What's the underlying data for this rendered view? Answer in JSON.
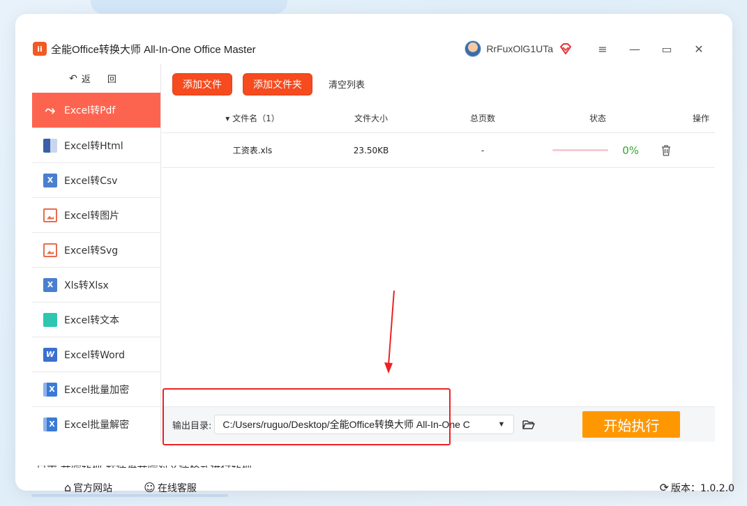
{
  "app": {
    "title": "全能Office转换大师 All-In-One Office Master",
    "logo_text": "ii",
    "username": "RrFuxOlG1UTa"
  },
  "window_controls": {
    "menu": "≡",
    "minimize": "—",
    "maximize": "▭",
    "close": "✕"
  },
  "sidebar": {
    "back_label": "返 回",
    "items": [
      {
        "label": "Excel转Pdf",
        "icon": "pdf-icon",
        "active": true
      },
      {
        "label": "Excel转Html",
        "icon": "html-icon"
      },
      {
        "label": "Excel转Csv",
        "icon": "csv-icon",
        "glyph": "X"
      },
      {
        "label": "Excel转图片",
        "icon": "image-icon"
      },
      {
        "label": "Excel转Svg",
        "icon": "svg-icon"
      },
      {
        "label": "Xls转Xlsx",
        "icon": "xlsx-icon",
        "glyph": "X"
      },
      {
        "label": "Excel转文本",
        "icon": "text-icon"
      },
      {
        "label": "Excel转Word",
        "icon": "word-icon",
        "glyph": "W"
      },
      {
        "label": "Excel批量加密",
        "icon": "encrypt-icon",
        "glyph": "X"
      },
      {
        "label": "Excel批量解密",
        "icon": "decrypt-icon",
        "glyph": "X"
      }
    ]
  },
  "toolbar": {
    "add_file": "添加文件",
    "add_folder": "添加文件夹",
    "clear_list": "清空列表"
  },
  "table": {
    "headers": {
      "name": "▾ 文件名（1）",
      "size": "文件大小",
      "pages": "总页数",
      "status": "状态",
      "actions": "操作"
    },
    "rows": [
      {
        "name": "工资表.xls",
        "size": "23.50KB",
        "pages": "-",
        "progress": 0,
        "progress_text": "0%"
      }
    ]
  },
  "output": {
    "label": "输出目录:",
    "path": "C:/Users/ruguo/Desktop/全能Office转换大师 All-In-One C",
    "start_button": "开始执行"
  },
  "footer": {
    "website": "官方网站",
    "support": "在线客服",
    "version": "版本：1.0.2.0"
  },
  "background_text": "点击 开始转换 软件将开始对文件格式进行转换。",
  "colors": {
    "accent_red": "#fd6450",
    "button_orange_red": "#f64a1f",
    "start_orange": "#ff9800",
    "progress_green": "#2fa82f",
    "annotation_red": "#ee2222"
  }
}
